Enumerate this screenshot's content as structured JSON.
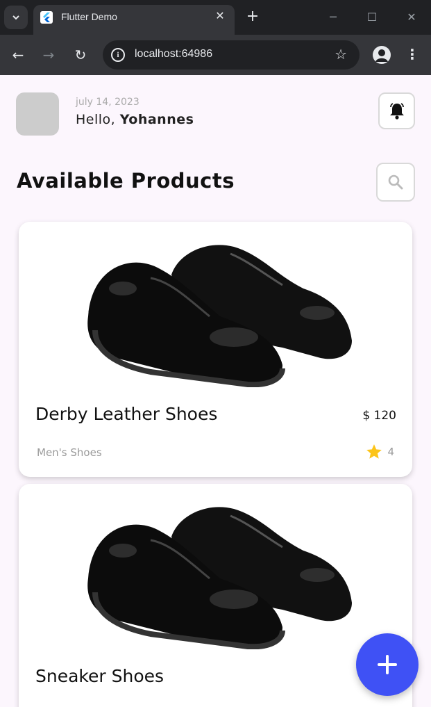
{
  "browser": {
    "tab_title": "Flutter Demo",
    "url": "localhost:64986"
  },
  "header": {
    "date": "july 14, 2023",
    "greeting_prefix": "Hello, ",
    "user_name": "Yohannes"
  },
  "section": {
    "title": "Available Products"
  },
  "products": [
    {
      "name": "Derby Leather Shoes",
      "price": "$ 120",
      "category": "Men's Shoes",
      "rating": "4"
    },
    {
      "name": "Sneaker Shoes"
    }
  ],
  "colors": {
    "accent": "#3f51f5",
    "star": "#fcc419",
    "background": "#fcf6fd"
  },
  "icons": {
    "notification": "bell-icon",
    "search": "search-icon",
    "add": "plus-icon",
    "rating": "star-icon"
  }
}
